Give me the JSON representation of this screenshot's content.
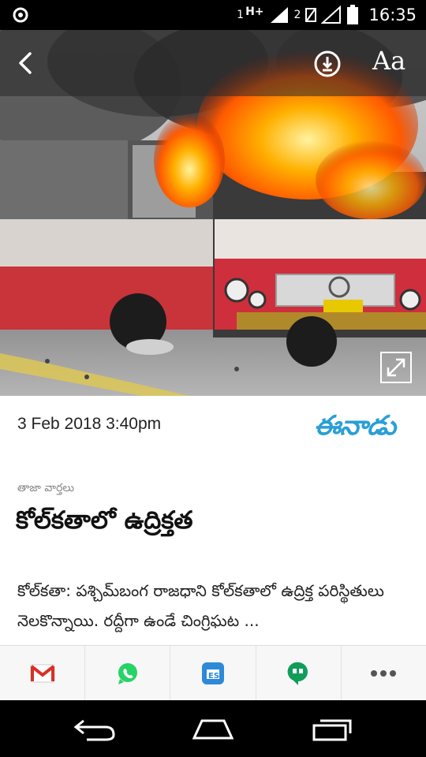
{
  "status_bar": {
    "sim1": "1",
    "network": "H+",
    "sim2": "2",
    "time": "16:35"
  },
  "toolbar": {
    "font_size_label": "Aa"
  },
  "article": {
    "date": "3 Feb 2018 3:40pm",
    "source_logo": "ఈనాడు",
    "category": "తాజా వార్తలు",
    "headline": "కోల్‌కతాలో ఉద్రిక్తత",
    "body": "కోల్‌కతా: పశ్చిమ్‌బంగ రాజధాని కోల్‌కతాలో ఉద్రిక్త పరిస్థితులు నెలకొన్నాయి. రద్దీగా ఉండే చింగ్రిఘట ..."
  },
  "share_bar": [
    "gmail-icon",
    "whatsapp-icon",
    "es-file-explorer-icon",
    "hangouts-icon",
    "more-icon"
  ],
  "colors": {
    "logo": "#2a9fd6",
    "whatsapp": "#25d366",
    "hangouts": "#0f9d58",
    "gmail": "#d93025",
    "es_explorer": "#2d8ad8"
  }
}
